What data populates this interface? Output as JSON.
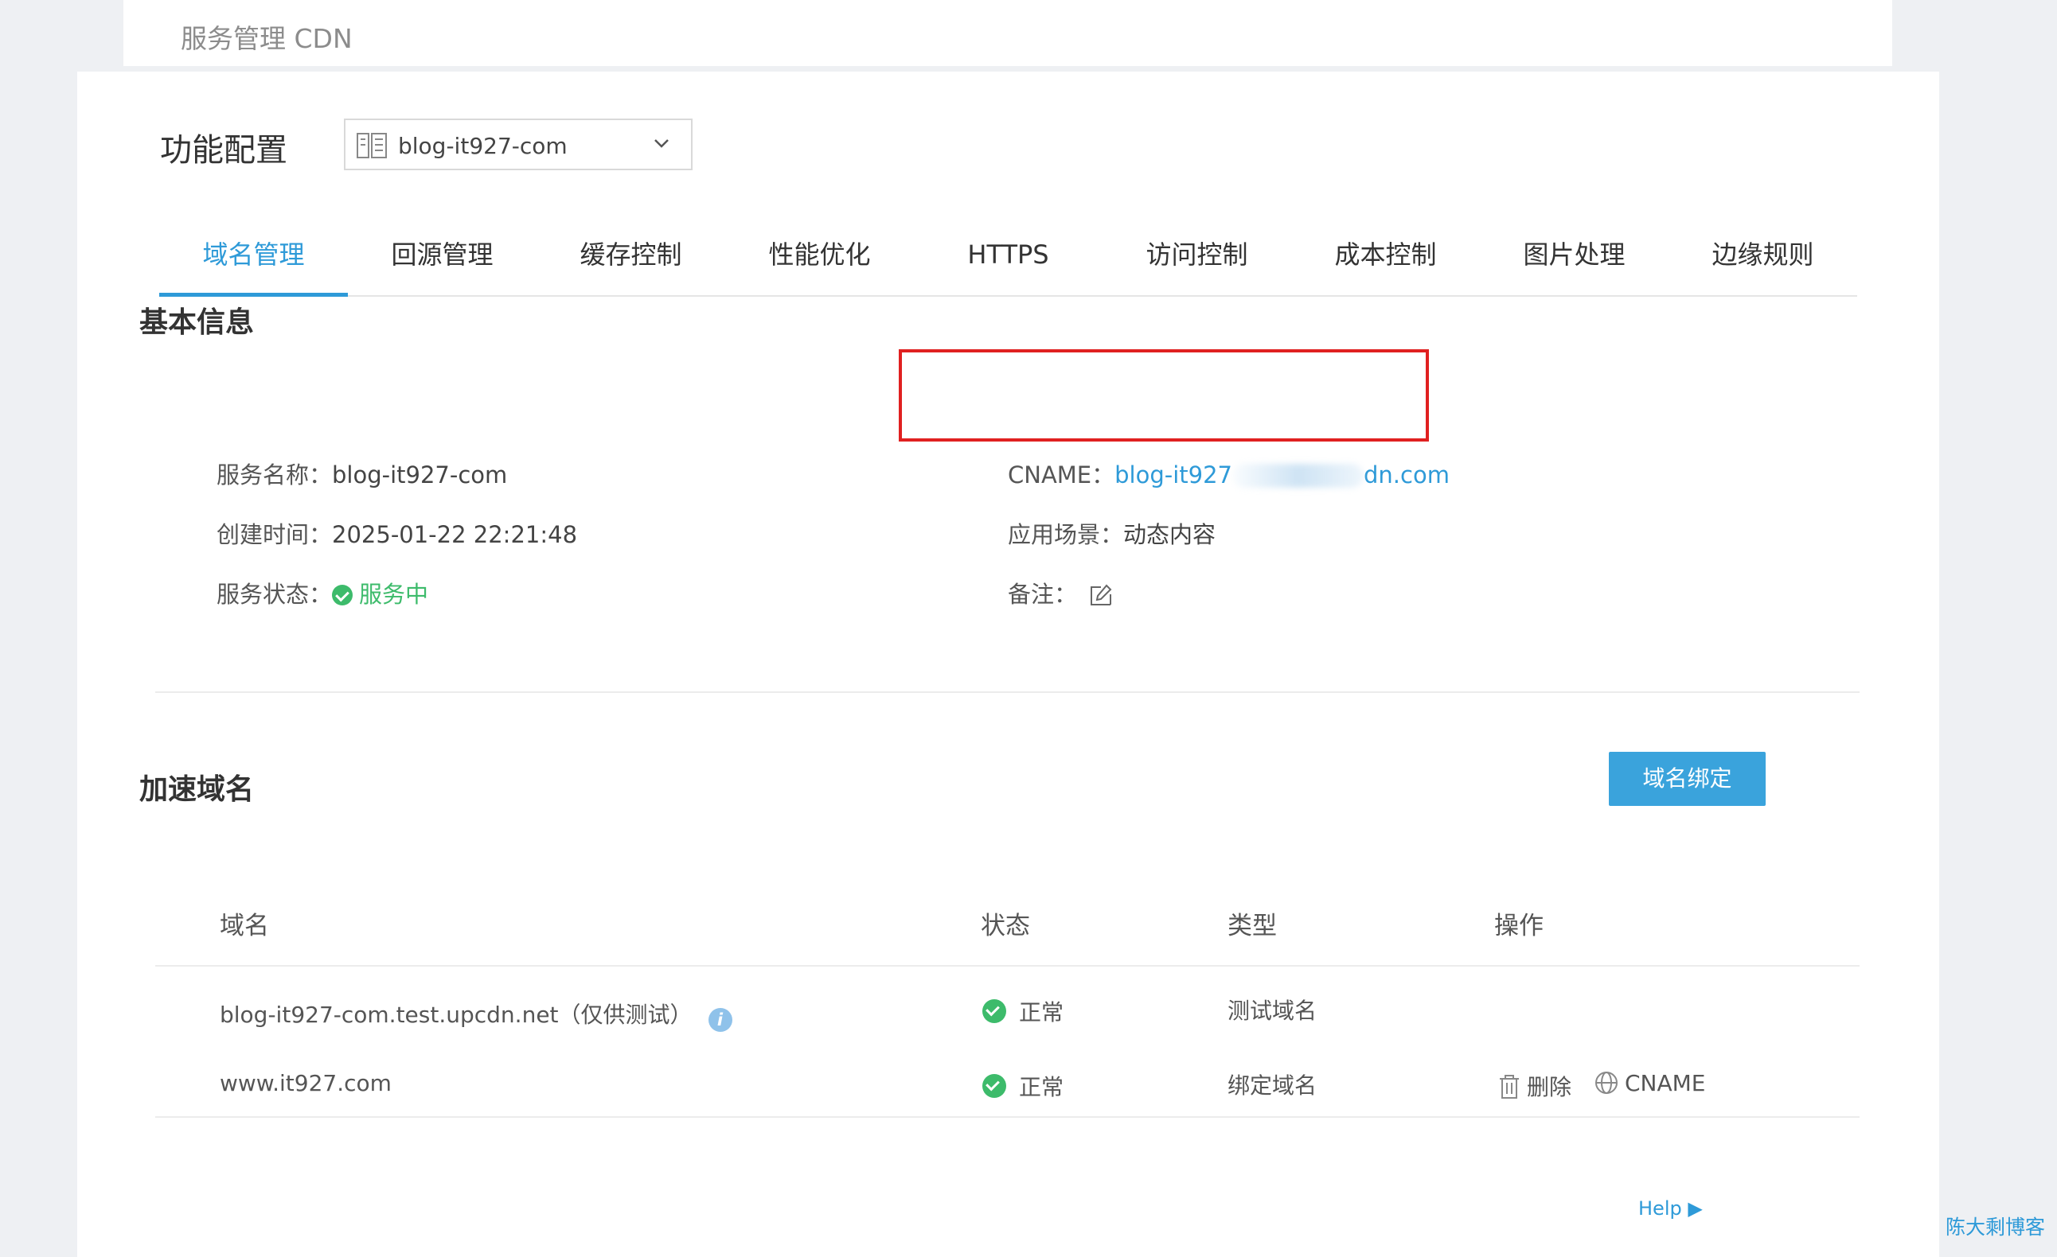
{
  "topbar": {
    "title": "服务管理 CDN"
  },
  "header": {
    "section_label": "功能配置",
    "service_select": {
      "value": "blog-it927-com"
    }
  },
  "tabs": [
    {
      "label": "域名管理",
      "active": true
    },
    {
      "label": "回源管理",
      "active": false
    },
    {
      "label": "缓存控制",
      "active": false
    },
    {
      "label": "性能优化",
      "active": false
    },
    {
      "label": "HTTPS",
      "active": false
    },
    {
      "label": "访问控制",
      "active": false
    },
    {
      "label": "成本控制",
      "active": false
    },
    {
      "label": "图片处理",
      "active": false
    },
    {
      "label": "边缘规则",
      "active": false
    }
  ],
  "basic_info": {
    "title": "基本信息",
    "service_name_label": "服务名称：",
    "service_name_value": "blog-it927-com",
    "created_label": "创建时间：",
    "created_value": "2025-01-22 22:21:48",
    "status_label": "服务状态：",
    "status_value": "服务中",
    "cname_label": "CNAME：",
    "cname_value_start": "blog-it927",
    "cname_value_end": "dn.com",
    "scene_label": "应用场景：",
    "scene_value": "动态内容",
    "remark_label": "备注："
  },
  "accel_domains": {
    "title": "加速域名",
    "bind_button": "域名绑定",
    "columns": [
      "域名",
      "状态",
      "类型",
      "操作"
    ],
    "rows": [
      {
        "domain": "blog-it927-com.test.upcdn.net（仅供测试）",
        "status": "正常",
        "type": "测试域名",
        "has_info_icon": true
      },
      {
        "domain": "www.it927.com",
        "status": "正常",
        "type": "绑定域名",
        "delete_label": "删除",
        "cname_label": "CNAME"
      }
    ]
  },
  "footer": {
    "help": "Help ▶",
    "watermark": "陈大剩博客"
  },
  "colors": {
    "accent": "#2e9ad8",
    "success": "#3dbb6b",
    "highlight_border": "#e02020"
  }
}
